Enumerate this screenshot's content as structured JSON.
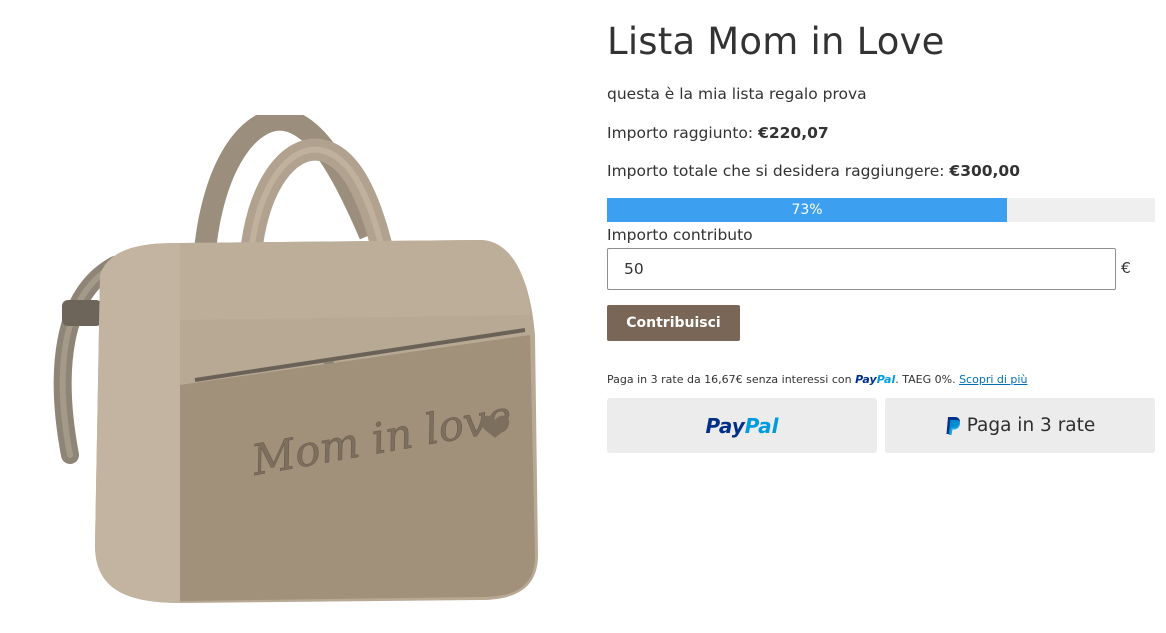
{
  "product": {
    "image_name": "bag-photo",
    "embossed_text": "Mom in love"
  },
  "list": {
    "title": "Lista Mom in Love",
    "description": "questa è la mia lista regalo prova",
    "reached_label": "Importo raggiunto: ",
    "reached_value": "€220,07",
    "target_label": "Importo totale che si desidera raggiungere: ",
    "target_value": "€300,00"
  },
  "progress": {
    "fraction": 0.73,
    "label": "73%",
    "color": "#3d9ff0",
    "track_color": "#efefef"
  },
  "contribution": {
    "label": "Importo contributo",
    "value": "50",
    "currency": "€",
    "button_label": "Contribuisci",
    "button_color": "#7a6656"
  },
  "paypal": {
    "message_prefix": "Paga in 3 rate da 16,67€ senza interessi con ",
    "brand_pay": "Pay",
    "brand_pal": "Pal",
    "message_suffix": ". TAEG 0%. ",
    "learn_more": "Scopri di più",
    "paylater_label": "Paga in 3 rate",
    "brand_dark": "#003087",
    "brand_light": "#009cde"
  }
}
